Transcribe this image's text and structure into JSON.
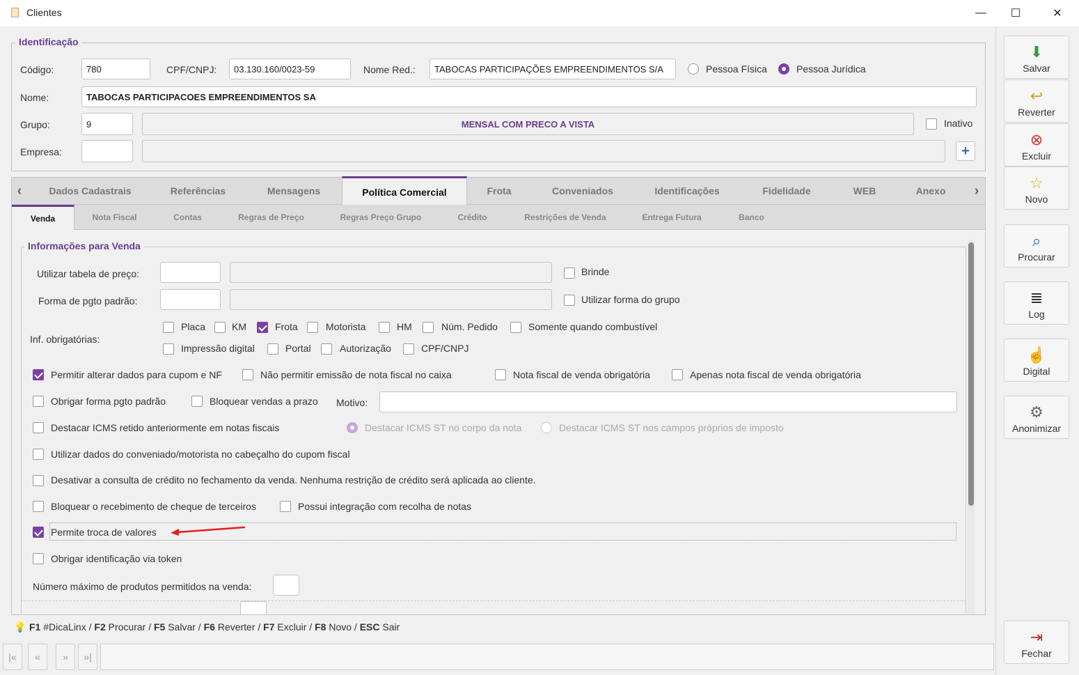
{
  "window": {
    "title": "Clientes",
    "min": "—",
    "max": "☐",
    "close": "✕"
  },
  "identificacao": {
    "legend": "Identificação",
    "codigo_label": "Código:",
    "codigo": "780",
    "cpf_label": "CPF/CNPJ:",
    "cpf": "03.130.160/0023-59",
    "nome_red_label": "Nome Red.:",
    "nome_red": "TABOCAS PARTICIPAÇÕES EMPREENDIMENTOS S/A",
    "pessoa_fisica": "Pessoa Física",
    "pessoa_juridica": "Pessoa Jurídica",
    "nome_label": "Nome:",
    "nome": "TABOCAS PARTICIPACOES EMPREENDIMENTOS SA",
    "grupo_label": "Grupo:",
    "grupo": "9",
    "grupo_desc": "MENSAL COM PRECO A VISTA",
    "inativo": "Inativo",
    "empresa_label": "Empresa:",
    "empresa": "",
    "empresa_desc": ""
  },
  "tabs": [
    "Dados Cadastrais",
    "Referências",
    "Mensagens",
    "Política Comercial",
    "Frota",
    "Conveniados",
    "Identificações",
    "Fidelidade",
    "WEB",
    "Anexo"
  ],
  "subtabs": [
    "Venda",
    "Nota Fiscal",
    "Contas",
    "Regras de Preço",
    "Regras Preço Grupo",
    "Crédito",
    "Restrições de Venda",
    "Entrega Futura",
    "Banco"
  ],
  "venda": {
    "legend": "Informações para Venda",
    "tabela_label": "Utilizar tabela de preço:",
    "forma_label": "Forma de pgto padrão:",
    "brinde": "Brinde",
    "utilizar_forma_grupo": "Utilizar forma do grupo",
    "inf_obrig_label": "Inf. obrigatórias:",
    "obrig": [
      "Placa",
      "KM",
      "Frota",
      "Motorista",
      "HM",
      "Núm. Pedido",
      "Somente quando combustível",
      "Impressão digital",
      "Portal",
      "Autorização",
      "CPF/CNPJ"
    ],
    "permitir_alterar": "Permitir alterar dados para cupom e NF",
    "nao_permitir_emissao": "Não permitir emissão de nota fiscal no caixa",
    "nf_obrig": "Nota fiscal de venda obrigatória",
    "apenas_nf_obrig": "Apenas nota fiscal de venda obrigatória",
    "obrigar_forma": "Obrigar forma pgto padrão",
    "bloquear_prazo": "Bloquear vendas a prazo",
    "motivo_label": "Motivo:",
    "destacar_icms": "Destacar ICMS retido anteriormente em notas fiscais",
    "icms_corpo": "Destacar ICMS  ST no corpo da nota",
    "icms_campos": "Destacar ICMS ST nos campos próprios de imposto",
    "utilizar_dados": "Utilizar dados do conveniado/motorista no cabeçalho do cupom fiscal",
    "desativar_credito": "Desativar a consulta de crédito no fechamento da venda. Nenhuma restrição de crédito será aplicada ao cliente.",
    "bloquear_cheque": "Bloquear o recebimento de cheque de terceiros",
    "integracao_recolha": "Possui integração com recolha de notas",
    "troca_valores": "Permite troca de valores",
    "obrigar_token": "Obrigar identificação via token",
    "max_produtos_label": "Número máximo de produtos permitidos na venda:"
  },
  "sidebar": [
    "Salvar",
    "Reverter",
    "Excluir",
    "Novo",
    "Procurar",
    "Log",
    "Digital",
    "Anonimizar",
    "Fechar"
  ],
  "hints": [
    {
      "key": "F1",
      "text": " #DicaLinx / "
    },
    {
      "key": "F2",
      "text": " Procurar / "
    },
    {
      "key": "F5",
      "text": " Salvar / "
    },
    {
      "key": "F6",
      "text": " Reverter / "
    },
    {
      "key": "F7",
      "text": " Excluir / "
    },
    {
      "key": "F8",
      "text": " Novo / "
    },
    {
      "key": "ESC",
      "text": " Sair"
    }
  ],
  "colors": {
    "accent": "#7b3fa8",
    "legend": "#6a3d8f",
    "arrow": "#e02020"
  }
}
